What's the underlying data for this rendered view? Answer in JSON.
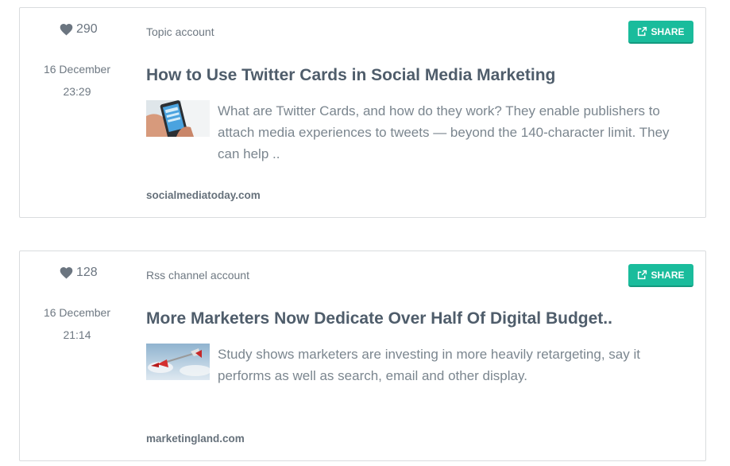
{
  "colors": {
    "share_button": "#1abc9c",
    "title": "#4f5d6b",
    "muted_text": "#7b868f",
    "border": "#d9dcde"
  },
  "posts": [
    {
      "likes": "290",
      "date": "16 December",
      "time": "23:29",
      "account": "Topic account",
      "share_label": "SHARE",
      "title": "How to Use Twitter Cards in Social Media Marketing",
      "excerpt": "What are Twitter Cards, and how do they work? They enable publishers to attach media experiences to tweets — beyond the 140-character limit. They can help ..",
      "source": "socialmediatoday.com",
      "thumbnail_icon": "phone-twitter-thumbnail"
    },
    {
      "likes": "128",
      "date": "16 December",
      "time": "21:14",
      "account": "Rss channel account",
      "share_label": "SHARE",
      "title": "More Marketers Now Dedicate Over Half Of Digital Budget..",
      "excerpt": "Study shows marketers are investing in more heavily retargeting, say it performs as well as search, email and other display.",
      "source": "marketingland.com",
      "thumbnail_icon": "dart-thumbnail"
    }
  ]
}
